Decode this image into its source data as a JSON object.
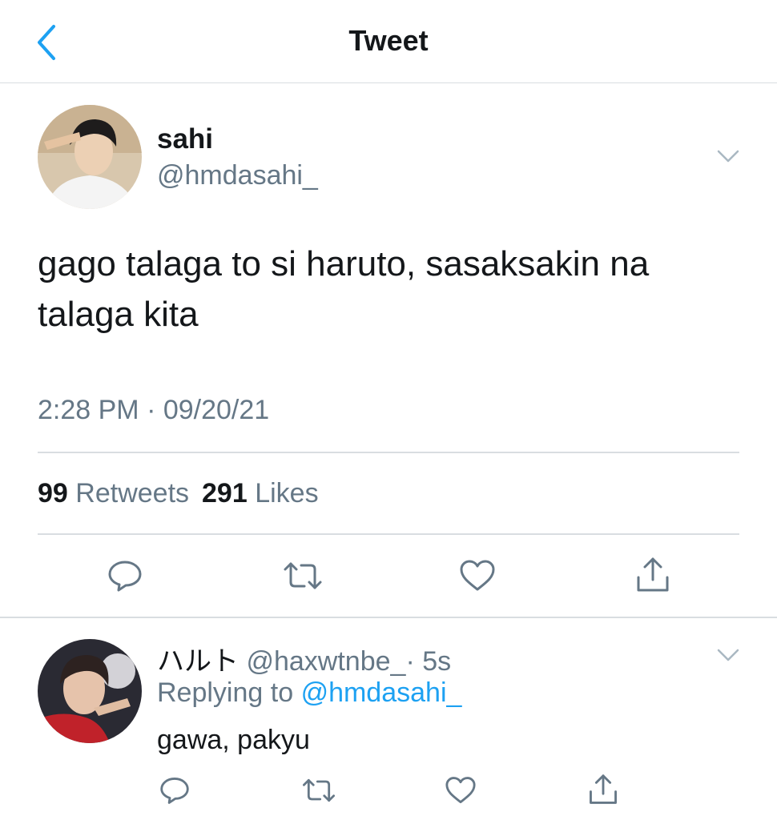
{
  "header": {
    "title": "Tweet",
    "back_icon": "chevron-left-icon",
    "accent_color": "#1da1f2"
  },
  "tweet": {
    "display_name": "sahi",
    "handle": "@hmdasahi_",
    "text": "gago talaga to si haruto, sasaksakin na talaga kita",
    "timestamp": "2:28 PM · 09/20/21",
    "retweets_count": "99",
    "retweets_label": "Retweets",
    "likes_count": "291",
    "likes_label": "Likes",
    "actions": [
      "reply-icon",
      "retweet-icon",
      "like-icon",
      "share-icon"
    ]
  },
  "reply": {
    "display_name": "ハルト",
    "handle": "@haxwtnbe_",
    "time_ago": "· 5s",
    "replying_prefix": "Replying to",
    "replying_to": "@hmdasahi_",
    "text": "gawa, pakyu",
    "actions": [
      "reply-icon",
      "retweet-icon",
      "like-icon",
      "share-icon"
    ]
  },
  "colors": {
    "text_primary": "#14171a",
    "text_secondary": "#657786",
    "link": "#1da1f2",
    "divider": "#d9dde1"
  }
}
